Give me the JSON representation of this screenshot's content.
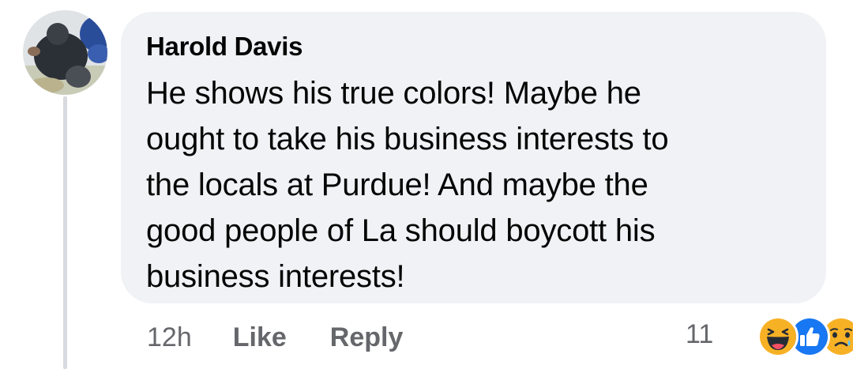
{
  "comment": {
    "author": "Harold Davis",
    "text": "He shows his true colors!  Maybe he\nought to take his business interests to\nthe locals at Purdue!  And maybe the\ngood people of La should boycott his\nbusiness interests!",
    "time": "12h",
    "like_label": "Like",
    "reply_label": "Reply",
    "reaction_count": "11",
    "reactions": [
      "haha-icon",
      "like-icon",
      "sad-icon"
    ]
  },
  "colors": {
    "bubble_bg": "#f0f2f5",
    "text": "#050505",
    "secondary_text": "#65676b",
    "thread_line": "#d8dadf",
    "like_blue": "#1877f2",
    "emoji_yellow": "#f7b125"
  }
}
